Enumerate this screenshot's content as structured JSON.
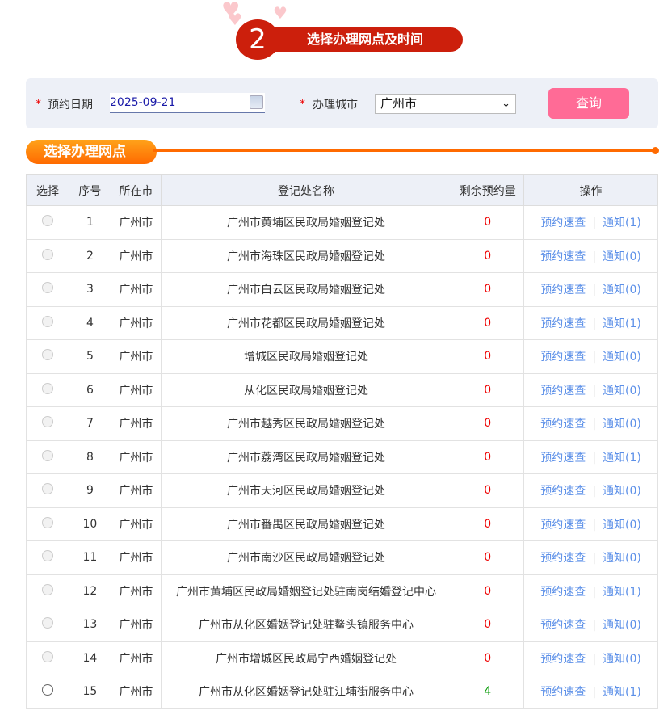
{
  "step": {
    "number": "2",
    "title": "选择办理网点及时间"
  },
  "search": {
    "date_label": "预约日期",
    "date_value": "2025-09-21",
    "city_label": "办理城市",
    "city_value": "广州市",
    "query_label": "查询",
    "required_mark": "*"
  },
  "section_title": "选择办理网点",
  "table": {
    "headers": [
      "选择",
      "序号",
      "所在市",
      "登记处名称",
      "剩余预约量",
      "操作"
    ],
    "book_label": "预约速查",
    "rows": [
      {
        "no": "1",
        "city": "广州市",
        "name": "广州市黄埔区民政局婚姻登记处",
        "remain": "0",
        "notice": "通知(1)"
      },
      {
        "no": "2",
        "city": "广州市",
        "name": "广州市海珠区民政局婚姻登记处",
        "remain": "0",
        "notice": "通知(0)"
      },
      {
        "no": "3",
        "city": "广州市",
        "name": "广州市白云区民政局婚姻登记处",
        "remain": "0",
        "notice": "通知(0)"
      },
      {
        "no": "4",
        "city": "广州市",
        "name": "广州市花都区民政局婚姻登记处",
        "remain": "0",
        "notice": "通知(1)"
      },
      {
        "no": "5",
        "city": "广州市",
        "name": "增城区民政局婚姻登记处",
        "remain": "0",
        "notice": "通知(0)"
      },
      {
        "no": "6",
        "city": "广州市",
        "name": "从化区民政局婚姻登记处",
        "remain": "0",
        "notice": "通知(0)"
      },
      {
        "no": "7",
        "city": "广州市",
        "name": "广州市越秀区民政局婚姻登记处",
        "remain": "0",
        "notice": "通知(0)"
      },
      {
        "no": "8",
        "city": "广州市",
        "name": "广州市荔湾区民政局婚姻登记处",
        "remain": "0",
        "notice": "通知(1)"
      },
      {
        "no": "9",
        "city": "广州市",
        "name": "广州市天河区民政局婚姻登记处",
        "remain": "0",
        "notice": "通知(0)"
      },
      {
        "no": "10",
        "city": "广州市",
        "name": "广州市番禺区民政局婚姻登记处",
        "remain": "0",
        "notice": "通知(0)"
      },
      {
        "no": "11",
        "city": "广州市",
        "name": "广州市南沙区民政局婚姻登记处",
        "remain": "0",
        "notice": "通知(0)"
      },
      {
        "no": "12",
        "city": "广州市",
        "name": "广州市黄埔区民政局婚姻登记处驻南岗结婚登记中心",
        "remain": "0",
        "notice": "通知(1)"
      },
      {
        "no": "13",
        "city": "广州市",
        "name": "广州市从化区婚姻登记处驻鳌头镇服务中心",
        "remain": "0",
        "notice": "通知(0)"
      },
      {
        "no": "14",
        "city": "广州市",
        "name": "广州市增城区民政局宁西婚姻登记处",
        "remain": "0",
        "notice": "通知(0)"
      },
      {
        "no": "15",
        "city": "广州市",
        "name": "广州市从化区婚姻登记处驻江埔街服务中心",
        "remain": "4",
        "notice": "通知(1)"
      }
    ]
  }
}
